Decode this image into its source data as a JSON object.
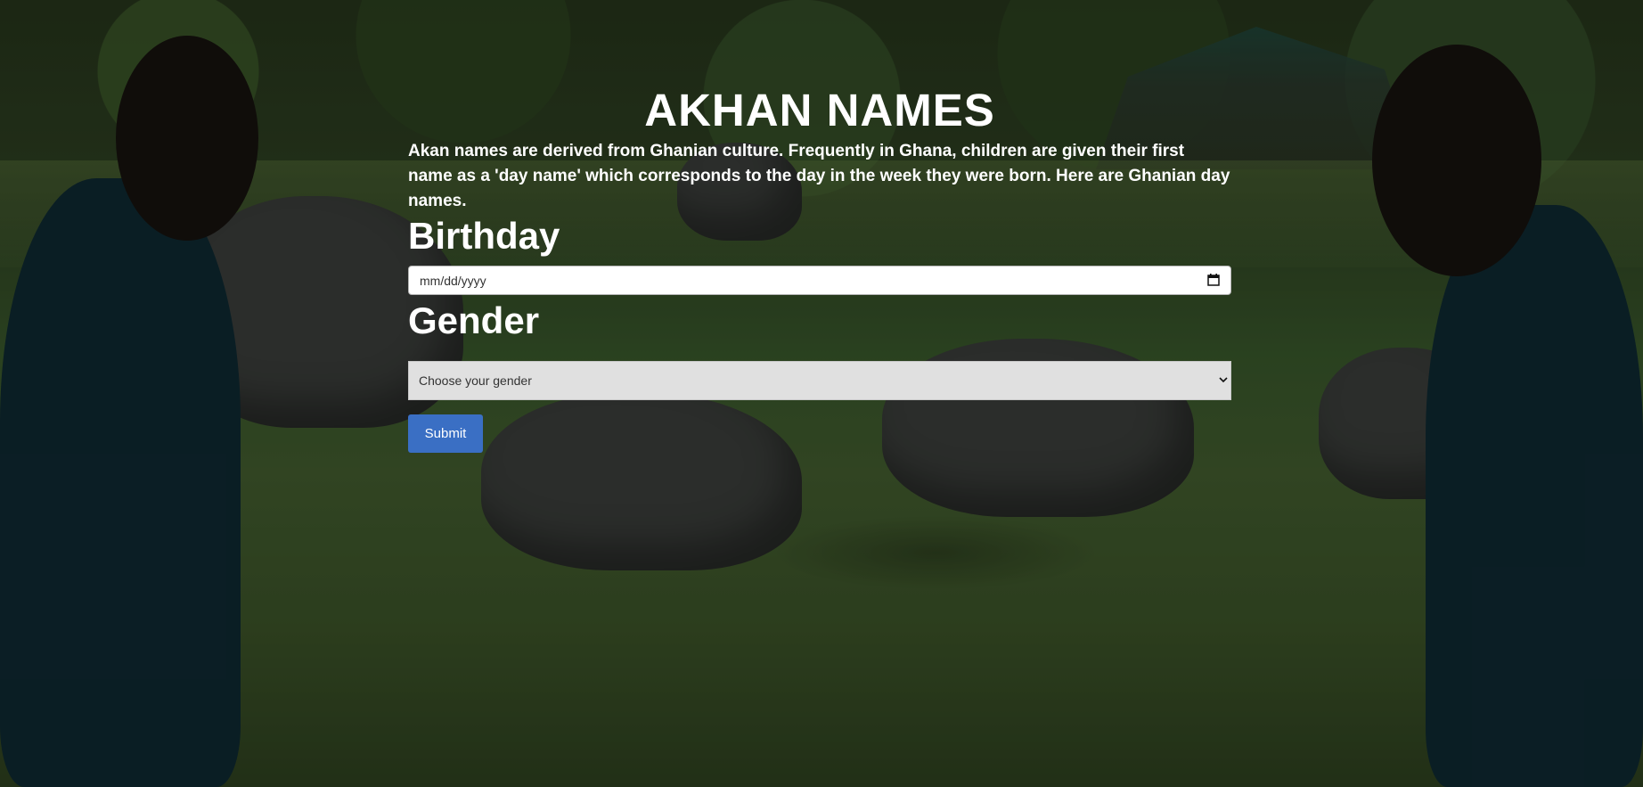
{
  "page": {
    "title": "AKHAN NAMES",
    "intro": "Akan names are derived from Ghanian culture. Frequently in Ghana, children are given their first name as a 'day name' which corresponds to the day in the week they were born. Here are Ghanian day names."
  },
  "form": {
    "birthday_heading": "Birthday",
    "date_placeholder": "mm/dd/yyyy",
    "gender_heading": "Gender",
    "gender_selected": "Choose your gender",
    "submit_label": "Submit"
  },
  "icons": {
    "calendar": "calendar-icon",
    "chevron": "chevron-down-icon"
  },
  "colors": {
    "submit": "#3a6fc4",
    "text": "#ffffff",
    "select_bg": "#e0e0e0"
  }
}
